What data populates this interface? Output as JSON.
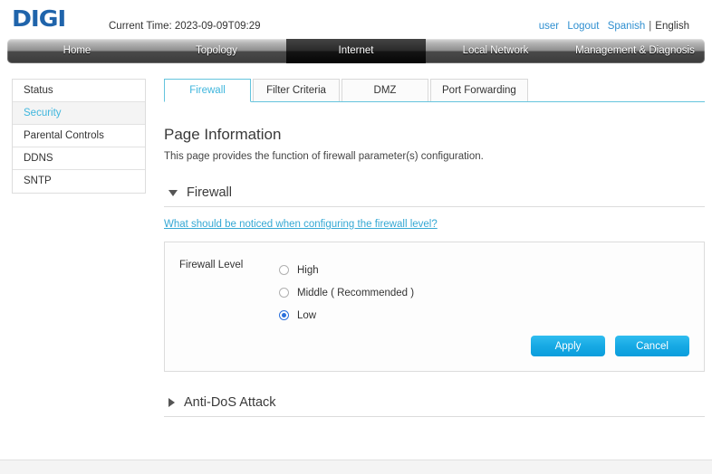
{
  "header": {
    "logo_text": "DIGI",
    "current_time_label": "Current Time: 2023-09-09T09:29",
    "user_link": "user",
    "logout_link": "Logout",
    "lang_other": "Spanish",
    "lang_separator": "|",
    "lang_current": "English",
    "logo_color": "#1f64ab",
    "link_color": "#2f8fd0"
  },
  "mainnav": {
    "items": [
      {
        "label": "Home",
        "active": false
      },
      {
        "label": "Topology",
        "active": false
      },
      {
        "label": "Internet",
        "active": true
      },
      {
        "label": "Local Network",
        "active": false
      },
      {
        "label": "Management & Diagnosis",
        "active": false
      }
    ]
  },
  "sidebar": {
    "items": [
      {
        "label": "Status",
        "active": false
      },
      {
        "label": "Security",
        "active": true
      },
      {
        "label": "Parental Controls",
        "active": false
      },
      {
        "label": "DDNS",
        "active": false
      },
      {
        "label": "SNTP",
        "active": false
      }
    ],
    "active_color": "#3fb6dd"
  },
  "subtabs": {
    "items": [
      {
        "label": "Firewall",
        "active": true
      },
      {
        "label": "Filter Criteria",
        "active": false
      },
      {
        "label": "DMZ",
        "active": false
      },
      {
        "label": "Port Forwarding",
        "active": false
      }
    ],
    "accent_color": "#64c4dd"
  },
  "page_info": {
    "title": "Page Information",
    "description": "This page provides the function of firewall parameter(s) configuration."
  },
  "firewall_section": {
    "title": "Firewall",
    "expanded": true,
    "notice_link": "What should be noticed when configuring the firewall level?",
    "field_label": "Firewall Level",
    "options": [
      {
        "label": "High",
        "selected": false
      },
      {
        "label": "Middle ( Recommended )",
        "selected": false
      },
      {
        "label": "Low",
        "selected": true
      }
    ],
    "apply_label": "Apply",
    "cancel_label": "Cancel",
    "button_color": "#17a9e4"
  },
  "antidos_section": {
    "title": "Anti-DoS Attack",
    "expanded": false
  }
}
